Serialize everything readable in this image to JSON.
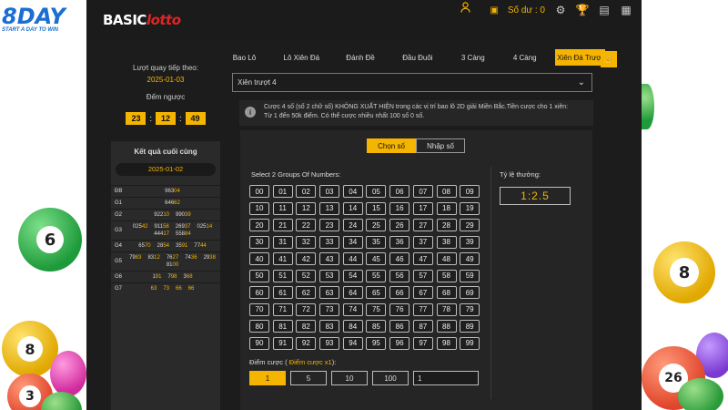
{
  "brand": {
    "name": "8DAY",
    "tagline": "START A DAY TO WIN"
  },
  "header": {
    "logo_basic": "BASIC",
    "logo_lotto": "lotto",
    "balance": "Số dư : 0"
  },
  "sidebar": {
    "next_label": "Lượt quay tiếp theo:",
    "next_date": "2025-01-03",
    "countdown_label": "Đếm ngược",
    "countdown": [
      "23",
      "12",
      "49"
    ],
    "results_title": "Kết quả cuối cùng",
    "results_date": "2025-01-02",
    "results": [
      {
        "prize": "ĐB",
        "nums": [
          [
            "963",
            "04"
          ]
        ]
      },
      {
        "prize": "G1",
        "nums": [
          [
            "646",
            "62"
          ]
        ]
      },
      {
        "prize": "G2",
        "nums": [
          [
            "922",
            "10"
          ],
          [
            "990",
            "39"
          ]
        ]
      },
      {
        "prize": "G3",
        "nums": [
          [
            "025",
            "42"
          ],
          [
            "911",
            "58"
          ],
          [
            "269",
            "37"
          ],
          [
            "025",
            "14"
          ],
          [
            "444",
            "17"
          ],
          [
            "558",
            "84"
          ]
        ]
      },
      {
        "prize": "G4",
        "nums": [
          [
            "65",
            "70"
          ],
          [
            "28",
            "54"
          ],
          [
            "35",
            "91"
          ],
          [
            "77",
            "44"
          ]
        ]
      },
      {
        "prize": "G5",
        "nums": [
          [
            "79",
            "83"
          ],
          [
            "83",
            "12"
          ],
          [
            "76",
            "27"
          ],
          [
            "74",
            "36"
          ],
          [
            "29",
            "38"
          ],
          [
            "81",
            "00"
          ]
        ]
      },
      {
        "prize": "G6",
        "nums": [
          [
            "1",
            "91"
          ],
          [
            "7",
            "98"
          ],
          [
            "3",
            "68"
          ]
        ]
      },
      {
        "prize": "G7",
        "nums": [
          [
            "",
            "63"
          ],
          [
            "",
            "73"
          ],
          [
            "",
            "66"
          ],
          [
            "",
            "66"
          ]
        ]
      }
    ]
  },
  "tabs": [
    "Bao Lô",
    "Lô Xiên Đá",
    "Đánh Đề",
    "Đầu Đuôi",
    "3 Càng",
    "4 Càng",
    "Xiên Đá Trượt"
  ],
  "active_tab": 6,
  "select": {
    "value": "Xiên trượt 4"
  },
  "info": {
    "line1": "Cược 4 số (số 2 chữ số) KHÔNG XUẤT HIỆN trong các vị trí bao lô 2D giải Miền Bắc.Tiền cược cho 1 xiên:",
    "line2": "Từ 1 đến 50k điểm. Có thể cược nhiều nhất 100 số 0 số."
  },
  "mode": {
    "choose_label": "Chọn số",
    "enter_label": "Nhập số"
  },
  "group_label": "Select 2 Groups Of Numbers:",
  "rate": {
    "label": "Tỷ lệ thưởng:",
    "value": "1:2.5"
  },
  "stake": {
    "label": "Điểm cược (",
    "label_highlight": " Điểm cược x1",
    "label_end": "):",
    "options": [
      "1",
      "5",
      "10",
      "100"
    ],
    "input_value": "1"
  },
  "colors": {
    "accent": "#f5b400",
    "background": "#1c1c1c",
    "brand_blue": "#1a6fd1",
    "logo_red": "#e02424"
  }
}
